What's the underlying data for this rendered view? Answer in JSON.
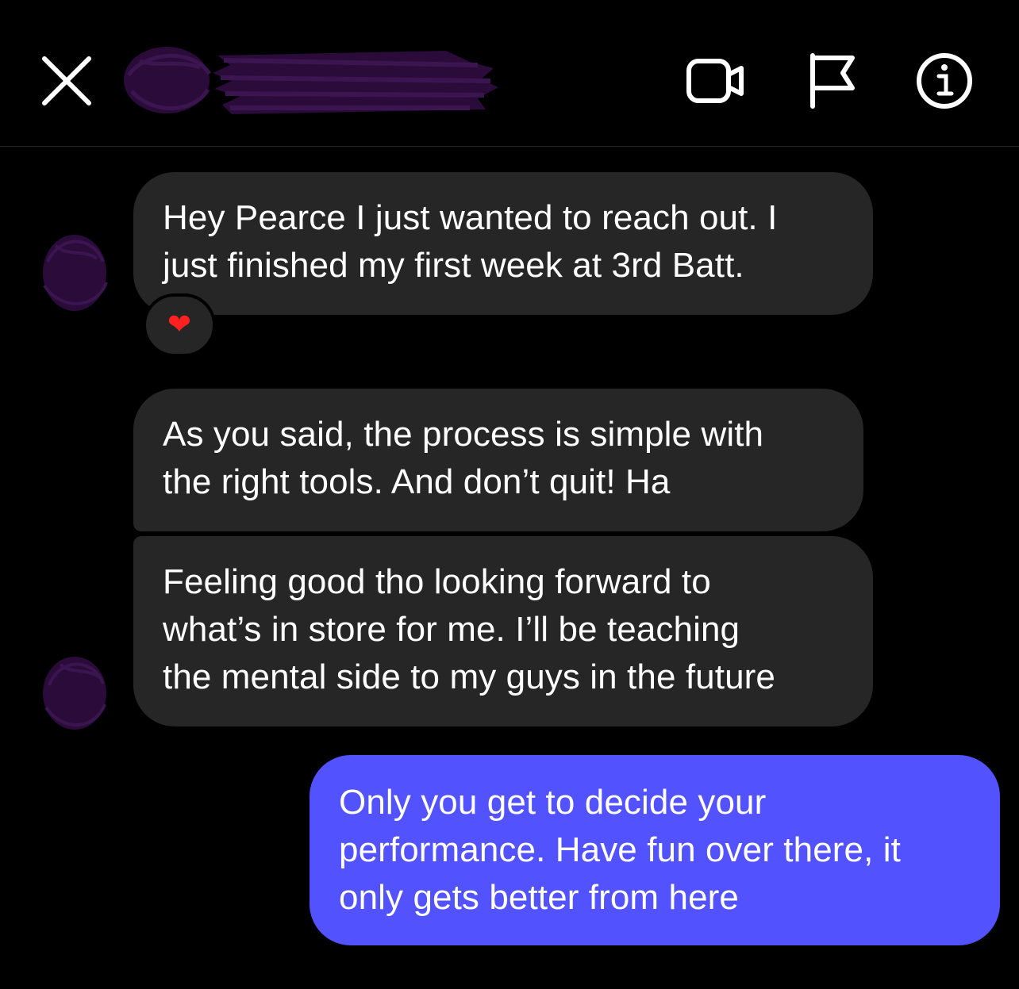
{
  "header": {
    "close_icon": "close-icon",
    "video_icon": "video-call-icon",
    "flag_icon": "flag-icon",
    "info_icon": "info-icon",
    "redaction_color": "#2b0b3a"
  },
  "messages": [
    {
      "direction": "incoming",
      "text": "Hey Pearce I just wanted to reach out. I\njust finished my first week at 3rd Batt.",
      "reaction": "❤"
    },
    {
      "direction": "incoming",
      "text": "As you said, the process is simple with\nthe right tools. And don’t quit! Ha"
    },
    {
      "direction": "incoming",
      "text": "Feeling good tho looking forward to\nwhat’s in store for me. I’ll be teaching\nthe mental side to my guys in the future"
    },
    {
      "direction": "outgoing",
      "text": "Only you get to decide your\nperformance. Have fun over there, it\nonly gets better from here"
    }
  ],
  "colors": {
    "background": "#000000",
    "incoming_bubble": "#262626",
    "outgoing_bubble": "#5252ff",
    "reaction_heart": "#ff2020"
  }
}
